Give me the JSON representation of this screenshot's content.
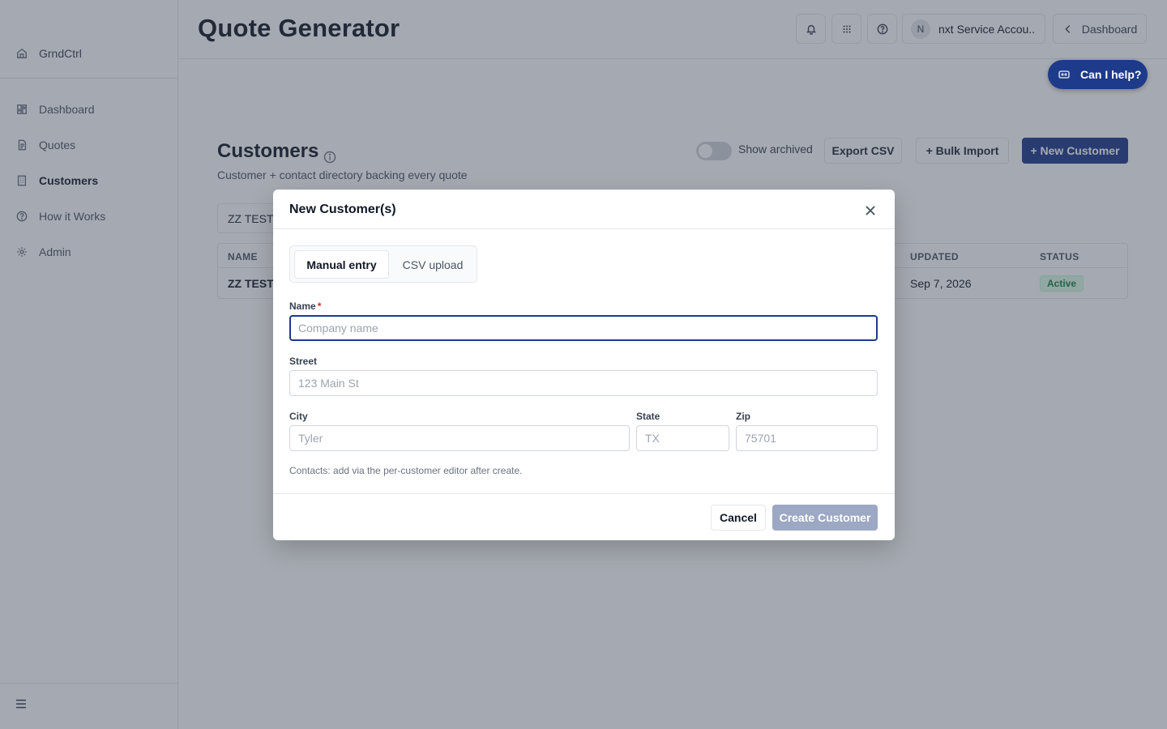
{
  "sidebar": {
    "brand": {
      "label": "GrndCtrl",
      "icon": "home-icon"
    },
    "items": [
      {
        "label": "Dashboard",
        "icon": "dashboard-grid-icon",
        "active": false
      },
      {
        "label": "Quotes",
        "icon": "document-icon",
        "active": false
      },
      {
        "label": "Customers",
        "icon": "building-icon",
        "active": true
      },
      {
        "label": "How it Works",
        "icon": "question-circle-icon",
        "active": false
      },
      {
        "label": "Admin",
        "icon": "gear-icon",
        "active": false
      }
    ],
    "menu_icon": "hamburger-icon"
  },
  "header": {
    "title": "Quote Generator",
    "buttons": [
      "bell-icon",
      "apps-grid-icon",
      "help-circle-icon"
    ],
    "account": {
      "initial": "N",
      "name": "nxt Service Accou..."
    },
    "back_label": "Dashboard"
  },
  "help_pill": {
    "label": "Can I help?"
  },
  "main": {
    "title": "Customers",
    "subtitle": "Customer + contact directory backing every quote",
    "show_archived_label": "Show archived",
    "show_archived_on": false,
    "export_label": "Export CSV",
    "bulk_import_label": "+ Bulk Import",
    "new_customer_label": "+ New Customer",
    "filter_value": "ZZ TEST",
    "table": {
      "columns": {
        "name": "NAME",
        "updated": "UPDATED",
        "status": "STATUS"
      },
      "rows": [
        {
          "name": "ZZ TEST",
          "updated": "Sep 7, 2026",
          "status": "Active"
        }
      ]
    }
  },
  "modal": {
    "title": "New Customer(s)",
    "tabs": {
      "manual": "Manual entry",
      "csv": "CSV upload",
      "active": "manual"
    },
    "fields": {
      "name": {
        "label": "Name",
        "required_mark": "*",
        "placeholder": "Company name",
        "value": ""
      },
      "street": {
        "label": "Street",
        "placeholder": "123 Main St",
        "value": ""
      },
      "city": {
        "label": "City",
        "placeholder": "Tyler",
        "value": ""
      },
      "state": {
        "label": "State",
        "placeholder": "TX",
        "value": ""
      },
      "zip": {
        "label": "Zip",
        "placeholder": "75701",
        "value": ""
      }
    },
    "contacts_note": "Contacts: add via the per-customer editor after create.",
    "cancel_label": "Cancel",
    "create_label": "Create Customer"
  },
  "colors": {
    "accent": "#1e3a8a",
    "active_badge_text": "#15803d",
    "active_badge_bg": "#dcfce7",
    "disabled_primary": "#9ca8c4"
  }
}
